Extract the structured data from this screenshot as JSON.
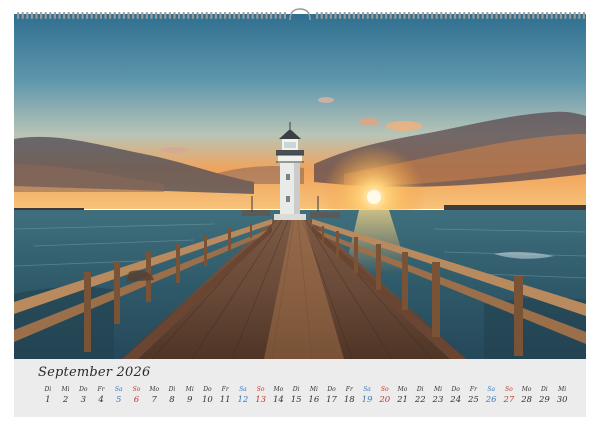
{
  "calendar": {
    "month_title": "September 2026",
    "days": [
      {
        "wd": "Di",
        "d": "1",
        "c": "#333333"
      },
      {
        "wd": "Mi",
        "d": "2",
        "c": "#333333"
      },
      {
        "wd": "Do",
        "d": "3",
        "c": "#333333"
      },
      {
        "wd": "Fr",
        "d": "4",
        "c": "#333333"
      },
      {
        "wd": "Sa",
        "d": "5",
        "c": "#3b7ab8"
      },
      {
        "wd": "So",
        "d": "6",
        "c": "#c0392b"
      },
      {
        "wd": "Mo",
        "d": "7",
        "c": "#333333"
      },
      {
        "wd": "Di",
        "d": "8",
        "c": "#333333"
      },
      {
        "wd": "Mi",
        "d": "9",
        "c": "#333333"
      },
      {
        "wd": "Do",
        "d": "10",
        "c": "#333333"
      },
      {
        "wd": "Fr",
        "d": "11",
        "c": "#333333"
      },
      {
        "wd": "Sa",
        "d": "12",
        "c": "#3b7ab8"
      },
      {
        "wd": "So",
        "d": "13",
        "c": "#c0392b"
      },
      {
        "wd": "Mo",
        "d": "14",
        "c": "#333333"
      },
      {
        "wd": "Di",
        "d": "15",
        "c": "#333333"
      },
      {
        "wd": "Mi",
        "d": "16",
        "c": "#333333"
      },
      {
        "wd": "Do",
        "d": "17",
        "c": "#333333"
      },
      {
        "wd": "Fr",
        "d": "18",
        "c": "#333333"
      },
      {
        "wd": "Sa",
        "d": "19",
        "c": "#3b7ab8"
      },
      {
        "wd": "So",
        "d": "20",
        "c": "#c0392b"
      },
      {
        "wd": "Mo",
        "d": "21",
        "c": "#333333"
      },
      {
        "wd": "Di",
        "d": "22",
        "c": "#333333"
      },
      {
        "wd": "Mi",
        "d": "23",
        "c": "#333333"
      },
      {
        "wd": "Do",
        "d": "24",
        "c": "#333333"
      },
      {
        "wd": "Fr",
        "d": "25",
        "c": "#333333"
      },
      {
        "wd": "Sa",
        "d": "26",
        "c": "#3b7ab8"
      },
      {
        "wd": "So",
        "d": "27",
        "c": "#c0392b"
      },
      {
        "wd": "Mo",
        "d": "28",
        "c": "#333333"
      },
      {
        "wd": "Di",
        "d": "29",
        "c": "#333333"
      },
      {
        "wd": "Mi",
        "d": "30",
        "c": "#333333"
      }
    ]
  }
}
